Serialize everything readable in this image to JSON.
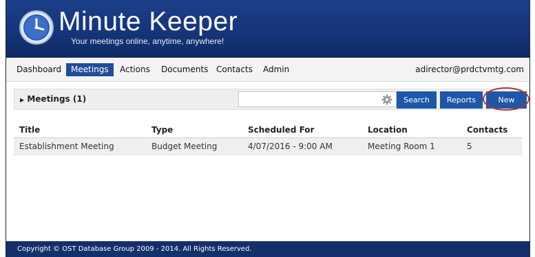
{
  "header": {
    "app_title": "Minute Keeper",
    "tagline": "Your meetings online, anytime, anywhere!"
  },
  "nav": {
    "items": [
      {
        "label": "Dashboard"
      },
      {
        "label": "Meetings"
      },
      {
        "label": "Actions"
      },
      {
        "label": "Documents"
      },
      {
        "label": "Contacts"
      },
      {
        "label": "Admin"
      }
    ],
    "active": "Meetings",
    "user_email": "adirector@prdctvmtg.com"
  },
  "panel": {
    "title": "Meetings (1)",
    "search_value": "",
    "search_button": "Search",
    "reports_button": "Reports",
    "new_button": "New"
  },
  "table": {
    "columns": [
      "Title",
      "Type",
      "Scheduled For",
      "Location",
      "Contacts"
    ],
    "rows": [
      [
        "Establishment Meeting",
        "Budget Meeting",
        "4/07/2016 - 9:00 AM",
        "Meeting Room 1",
        "5"
      ]
    ]
  },
  "footer": {
    "copyright": "Copyright © OST Database Group 2009 - 2014. All Rights Reserved."
  },
  "colors": {
    "header_blue": "#16357a",
    "accent_blue": "#1f57a8",
    "highlight_ring": "#b3342e"
  },
  "icons": {
    "logo": "clock-icon",
    "search_settings": "gear-icon",
    "panel_toggle": "triangle-right-icon"
  }
}
